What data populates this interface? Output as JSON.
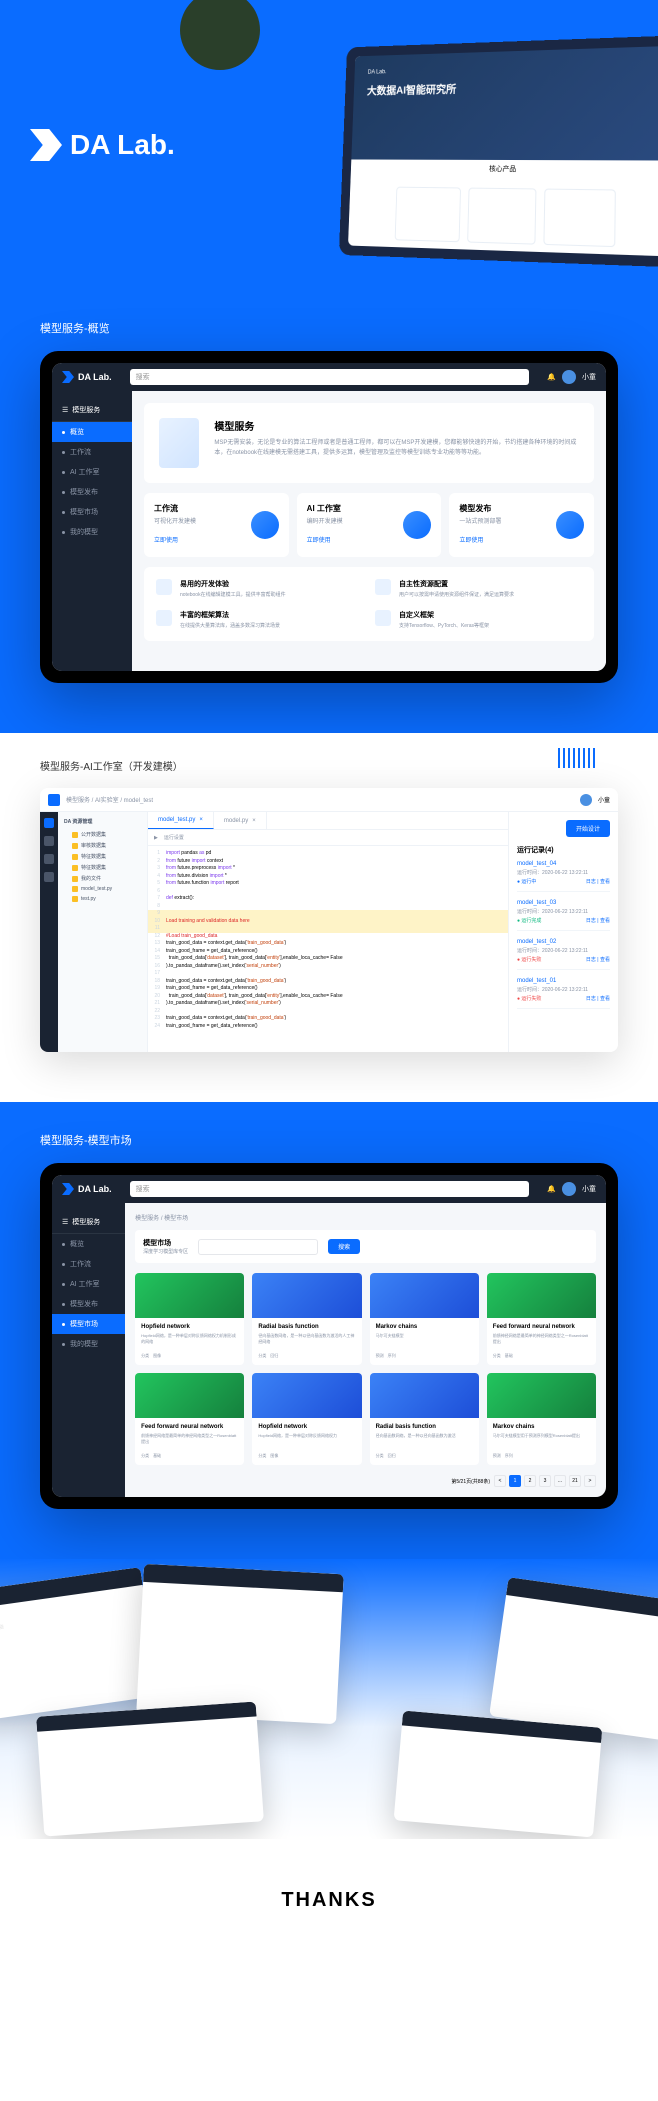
{
  "brand": "DA Lab.",
  "tablet": {
    "hero_title": "大数据AI智能研究所",
    "hero_sub": "核心产品"
  },
  "section1": {
    "title": "模型服务-概览",
    "search_placeholder": "搜索",
    "user": "小童",
    "sidebar_head": "模型服务",
    "sidebar": [
      {
        "label": "概览",
        "active": true
      },
      {
        "label": "工作流"
      },
      {
        "label": "AI 工作室"
      },
      {
        "label": "模型发布"
      },
      {
        "label": "模型市场"
      },
      {
        "label": "我的模型"
      }
    ],
    "hero": {
      "title": "模型服务",
      "desc": "MSP无需安装，无论是专业的算法工程师或者是普通工程师，都可以在MSP开发建模，您都能够快速的开始，节约搭建各种环境的时间成本，在notebook在线建模无需搭建工具，提供多运算，模型管理及监控等模型训练专业功能等等功能。"
    },
    "cards": [
      {
        "title": "工作流",
        "sub": "可视化开发建模",
        "link": "立即使用"
      },
      {
        "title": "AI 工作室",
        "sub": "编码开发建模",
        "link": "立即使用"
      },
      {
        "title": "模型发布",
        "sub": "一站式预测部署",
        "link": "立即使用"
      }
    ],
    "features": [
      {
        "title": "易用的开发体验",
        "desc": "notebook在线编辑建模工具，提供丰富帮助组件"
      },
      {
        "title": "自主性资源配置",
        "desc": "用户可以按需申请使用资源组件保证，满足运算要求"
      },
      {
        "title": "丰富的框架算法",
        "desc": "在线提供大量算法库，涵盖多数深习算法场景"
      },
      {
        "title": "自定义框架",
        "desc": "支持Tensorflow、PyTorch、Keras等框架"
      }
    ]
  },
  "section2": {
    "title": "模型服务-AI工作室（开发建模）",
    "breadcrumb": "模型服务 / AI实验室 / model_test",
    "user": "小童",
    "run_btn": "开始设计",
    "tree_head": "DA 资源管理",
    "tree": [
      "公开数据集",
      "审核数据集",
      "特征数据集",
      "特征数据集",
      "我的文件",
      "model_test.py",
      "test.py"
    ],
    "tabs": [
      {
        "name": "model_test.py",
        "active": true
      },
      {
        "name": "model.py"
      }
    ],
    "toolbar": "运行设置",
    "code": [
      {
        "n": 1,
        "t": "import pandas as pd",
        "cls": ""
      },
      {
        "n": 2,
        "t": "from future import context",
        "cls": ""
      },
      {
        "n": 3,
        "t": "from future.preprocess import *",
        "cls": ""
      },
      {
        "n": 4,
        "t": "from future.division import *",
        "cls": ""
      },
      {
        "n": 5,
        "t": "from future.function import report",
        "cls": ""
      },
      {
        "n": 6,
        "t": "",
        "cls": ""
      },
      {
        "n": 7,
        "t": "def extract():",
        "cls": ""
      },
      {
        "n": 8,
        "t": "",
        "cls": ""
      },
      {
        "n": 9,
        "t": "",
        "cls": "hl"
      },
      {
        "n": 10,
        "t": "Load training and validation data here",
        "cls": "cm hl"
      },
      {
        "n": 11,
        "t": "",
        "cls": "hl"
      },
      {
        "n": 12,
        "t": "#Load train_good_data",
        "cls": "cm"
      },
      {
        "n": 13,
        "t": "train_good_data = context.get_data('train_good_data')",
        "cls": ""
      },
      {
        "n": 14,
        "t": "train_good_frame = get_data_reference()",
        "cls": ""
      },
      {
        "n": 15,
        "t": "  train_good_data['dataset'], train_good_data['entity'],enable_loca_cache= False",
        "cls": ""
      },
      {
        "n": 16,
        "t": ").to_pandas_dataframe().set_index('serial_number')",
        "cls": ""
      },
      {
        "n": 17,
        "t": "",
        "cls": ""
      },
      {
        "n": 18,
        "t": "train_good_data = context.get_data('train_good_data')",
        "cls": ""
      },
      {
        "n": 19,
        "t": "train_good_frame = get_data_reference()",
        "cls": ""
      },
      {
        "n": 20,
        "t": "  train_good_data['dataset'], train_good_data['entity'],enable_loca_cache= False",
        "cls": ""
      },
      {
        "n": 21,
        "t": ").to_pandas_dataframe().set_index('serial_number')",
        "cls": ""
      },
      {
        "n": 22,
        "t": "",
        "cls": ""
      },
      {
        "n": 23,
        "t": "train_good_data = context.get_data('train_good_data')",
        "cls": ""
      },
      {
        "n": 24,
        "t": "train_good_frame = get_data_reference()",
        "cls": ""
      }
    ],
    "runs_title": "运行记录(4)",
    "runs": [
      {
        "name": "model_test_04",
        "time": "运行时间：2020-06-22 13:22:11",
        "status": "运行中",
        "cls": "st-run",
        "actions": "日志 | 查看"
      },
      {
        "name": "model_test_03",
        "time": "运行时间：2020-06-22 13:22:11",
        "status": "运行完成",
        "cls": "st-ok",
        "actions": "日志 | 查看"
      },
      {
        "name": "model_test_02",
        "time": "运行时间：2020-06-22 13:22:11",
        "status": "运行失败",
        "cls": "st-err",
        "actions": "日志 | 查看"
      },
      {
        "name": "model_test_01",
        "time": "运行时间：2020-06-22 13:22:11",
        "status": "运行失败",
        "cls": "st-err",
        "actions": "日志 | 查看"
      }
    ]
  },
  "section3": {
    "title": "模型服务-模型市场",
    "search_placeholder": "搜索",
    "user": "小童",
    "sidebar_head": "模型服务",
    "sidebar": [
      {
        "label": "概览"
      },
      {
        "label": "工作流"
      },
      {
        "label": "AI 工作室"
      },
      {
        "label": "模型发布"
      },
      {
        "label": "模型市场",
        "active": true
      },
      {
        "label": "我的模型"
      }
    ],
    "crumb": "模型服务 / 模型市场",
    "search_label": "模型市场",
    "search_sub": "深度学习模型库专区",
    "search_btn": "搜索",
    "models": [
      {
        "title": "Hopfield network",
        "desc": "Hopfield网络，是一种单层对称反馈网络权力机制形成的网络",
        "img": "green",
        "tags": "分类 图像"
      },
      {
        "title": "Radial basis function",
        "desc": "径向基函数网络，是一种以径向基函数为激活的人工神经网络",
        "img": "blue",
        "tags": "分类 回归"
      },
      {
        "title": "Markov chains",
        "desc": "马尔可夫链模型",
        "img": "blue",
        "tags": "预测 序列"
      },
      {
        "title": "Feed forward neural network",
        "desc": "前馈神经网络是最简单的神经网络类型之一Rosenblatt提出",
        "img": "green",
        "tags": "分类 基础"
      },
      {
        "title": "Feed forward neural network",
        "desc": "前馈神经网络是最简单的神经网络类型之一Rosenblatt提出",
        "img": "green",
        "tags": "分类 基础"
      },
      {
        "title": "Hopfield network",
        "desc": "Hopfield网络，是一种单层对称反馈网络权力",
        "img": "blue",
        "tags": "分类 图像"
      },
      {
        "title": "Radial basis function",
        "desc": "径向基函数网络，是一种以径向基函数为激活",
        "img": "blue",
        "tags": "分类 回归"
      },
      {
        "title": "Markov chains",
        "desc": "马尔可夫链模型用于预测序列模型Rosenblatt提出",
        "img": "green",
        "tags": "预测 序列"
      }
    ],
    "page_info": "第5/21页(共88条)",
    "pages": [
      "<",
      "1",
      "2",
      "3",
      "...",
      "21",
      ">"
    ]
  },
  "thanks": "THANKS"
}
